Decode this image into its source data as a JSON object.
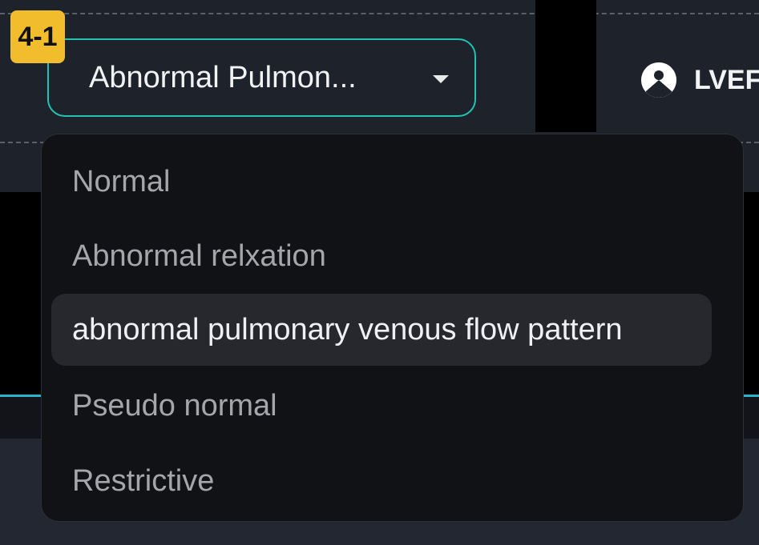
{
  "step": {
    "badge": "4-1"
  },
  "select": {
    "value": "Abnormal Pulmon..."
  },
  "header": {
    "right_label": "LVEF"
  },
  "dropdown": {
    "options": [
      "Normal",
      "Abnormal relxation",
      "abnormal pulmonary venous flow pattern",
      "Pseudo normal",
      "Restrictive"
    ],
    "selected_index": 2
  },
  "colors": {
    "accent": "#22c3b3",
    "badge": "#f2bd2d",
    "teal_line": "#2ab4c9",
    "background": "#1e222b"
  },
  "icons": {
    "select_caret": "chevron-down-icon",
    "lvef": "person-circle-icon"
  }
}
